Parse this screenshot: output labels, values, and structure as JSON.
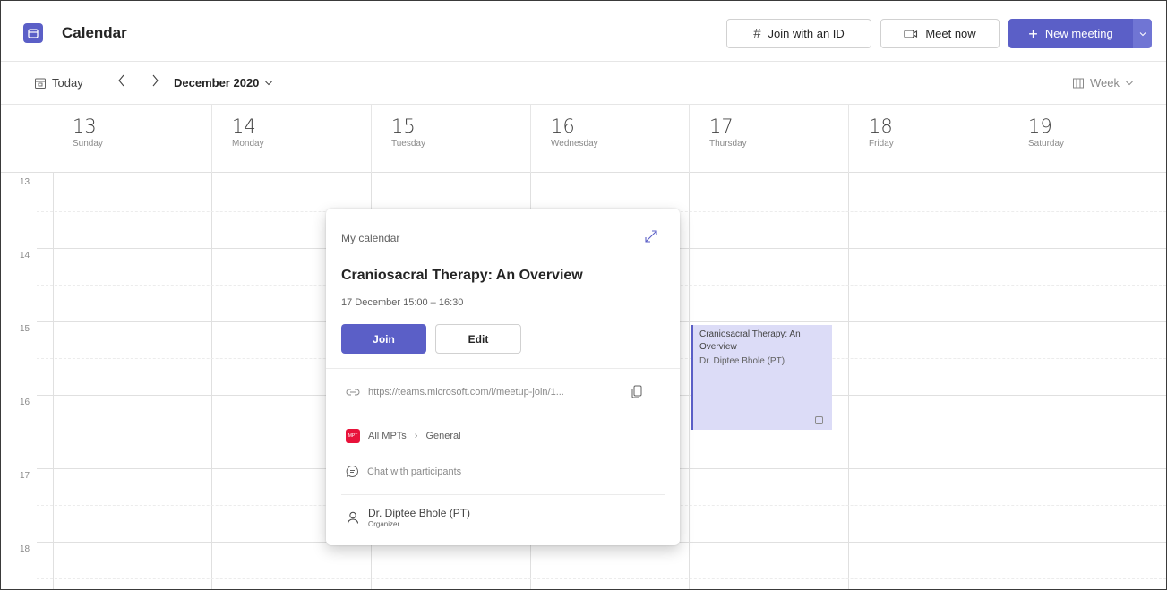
{
  "app": {
    "title": "Calendar"
  },
  "toolbar": {
    "join_id_label": "Join with an ID",
    "meet_now_label": "Meet now",
    "new_meeting_label": "New meeting"
  },
  "nav": {
    "today_label": "Today",
    "month_label": "December 2020",
    "view_label": "Week"
  },
  "days": [
    {
      "num": "13",
      "name": "Sunday"
    },
    {
      "num": "14",
      "name": "Monday"
    },
    {
      "num": "15",
      "name": "Tuesday"
    },
    {
      "num": "16",
      "name": "Wednesday"
    },
    {
      "num": "17",
      "name": "Thursday"
    },
    {
      "num": "18",
      "name": "Friday"
    },
    {
      "num": "19",
      "name": "Saturday"
    }
  ],
  "hours": [
    "13",
    "14",
    "15",
    "16",
    "17",
    "18"
  ],
  "event": {
    "title": "Craniosacral Therapy: An Overview",
    "organizer": "Dr. Diptee Bhole (PT)"
  },
  "popup": {
    "calendar_label": "My calendar",
    "title": "Craniosacral Therapy: An Overview",
    "time": "17 December 15:00 – 16:30",
    "join_label": "Join",
    "edit_label": "Edit",
    "link": "https://teams.microsoft.com/l/meetup-join/1...",
    "team": "All MPTs",
    "channel": "General",
    "team_badge": "MPT",
    "chat_label": "Chat with participants",
    "organizer_name": "Dr. Diptee Bhole (PT)",
    "organizer_role": "Organizer"
  },
  "colors": {
    "accent": "#5b5fc7",
    "event_bg": "#dcdcf7",
    "team_badge": "#e8123a"
  }
}
